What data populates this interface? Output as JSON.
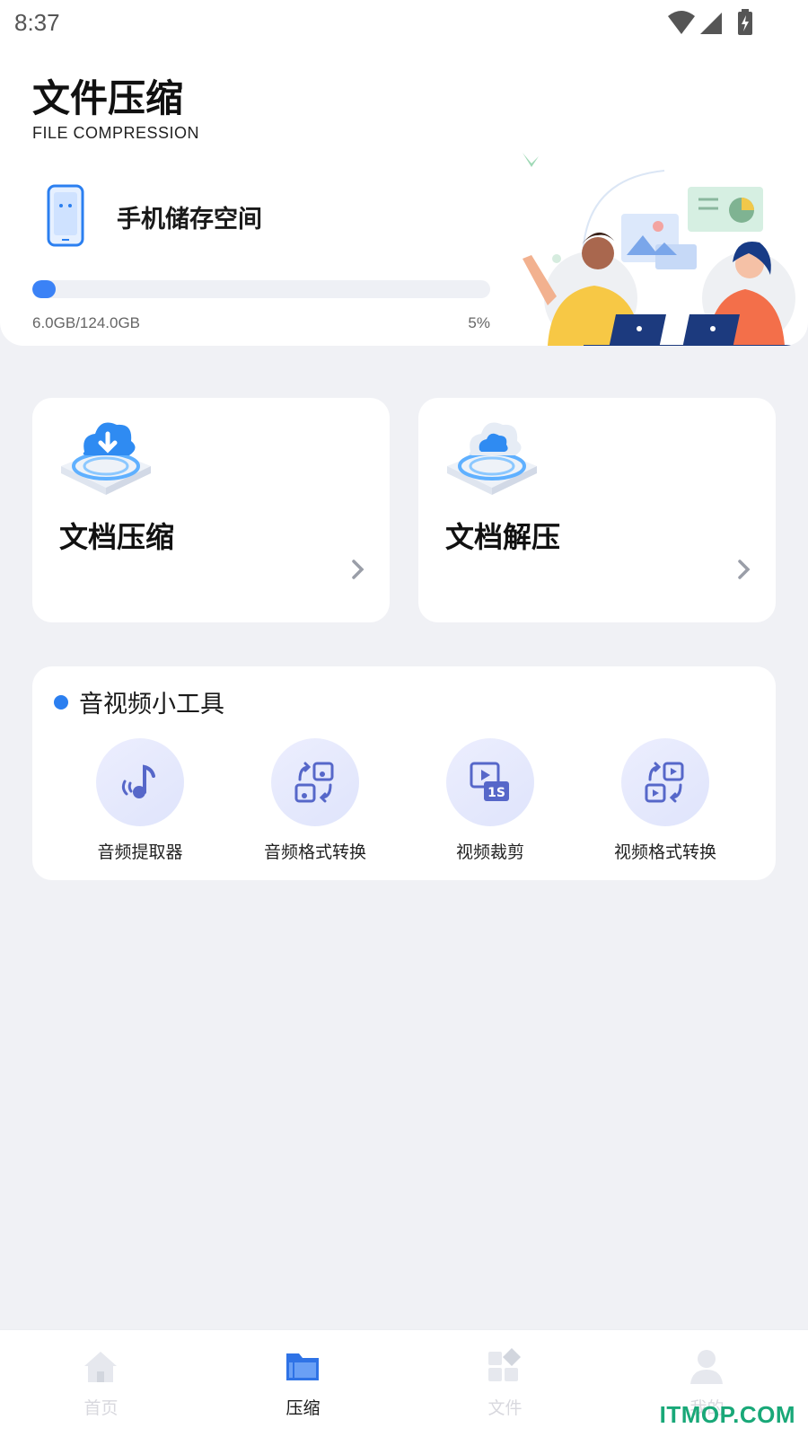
{
  "status_bar": {
    "time": "8:37",
    "icons": [
      "wifi-icon",
      "signal-icon",
      "battery-charging-icon"
    ]
  },
  "header": {
    "title": "文件压缩",
    "subtitle": "FILE COMPRESSION",
    "storage": {
      "label": "手机储存空间",
      "used_text": "6.0GB/124.0GB",
      "percent_text": "5%",
      "percent_value": 5
    }
  },
  "cards": [
    {
      "title": "文档压缩",
      "icon": "cloud-download-icon"
    },
    {
      "title": "文档解压",
      "icon": "cloud-icon"
    }
  ],
  "tools": {
    "title": "音视频小工具",
    "items": [
      {
        "label": "音频提取器",
        "icon": "music-note-icon"
      },
      {
        "label": "音频格式转换",
        "icon": "audio-convert-icon"
      },
      {
        "label": "视频裁剪",
        "icon": "video-trim-icon"
      },
      {
        "label": "视频格式转换",
        "icon": "video-convert-icon"
      }
    ]
  },
  "bottom_nav": {
    "items": [
      {
        "label": "首页",
        "icon": "home-icon",
        "active": false
      },
      {
        "label": "压缩",
        "icon": "folder-icon",
        "active": true
      },
      {
        "label": "文件",
        "icon": "apps-icon",
        "active": false
      },
      {
        "label": "我的",
        "icon": "user-icon",
        "active": false
      }
    ]
  },
  "colors": {
    "accent": "#3b82f6",
    "background": "#f0f1f5",
    "card": "#ffffff",
    "watermark": "#19a878"
  },
  "watermark": "ITMOP.COM"
}
